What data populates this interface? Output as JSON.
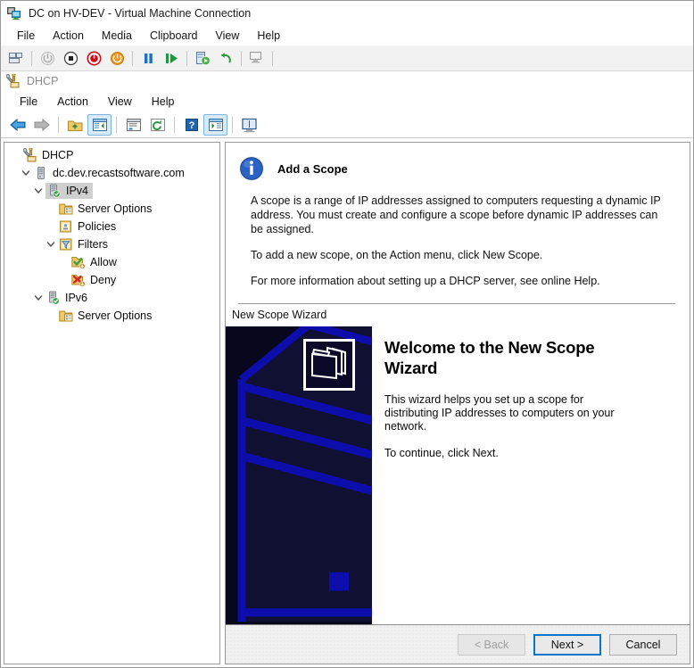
{
  "vm_window": {
    "title": "DC on HV-DEV - Virtual Machine Connection",
    "icon": "virtual-machine-icon",
    "menu": [
      "File",
      "Action",
      "Media",
      "Clipboard",
      "View",
      "Help"
    ],
    "toolbar": [
      {
        "name": "ctrl-alt-del-icon",
        "title": "Ctrl+Alt+Delete"
      },
      {
        "name": "start-icon",
        "title": "Start"
      },
      {
        "name": "shutdown-icon",
        "title": "Shut Down"
      },
      {
        "name": "turn-off-icon",
        "title": "Turn Off"
      },
      {
        "name": "save-state-icon",
        "title": "Save"
      },
      {
        "name": "pause-icon",
        "title": "Pause"
      },
      {
        "name": "resume-icon",
        "title": "Resume"
      },
      {
        "name": "checkpoint-icon",
        "title": "Checkpoint"
      },
      {
        "name": "revert-icon",
        "title": "Revert"
      },
      {
        "name": "enhanced-session-icon",
        "title": "Enhanced Session"
      }
    ]
  },
  "mmc": {
    "title": "DHCP",
    "icon": "dhcp-console-icon",
    "menu": [
      "File",
      "Action",
      "View",
      "Help"
    ],
    "toolbar": [
      {
        "name": "back-icon",
        "selected": false
      },
      {
        "name": "forward-icon",
        "selected": false
      },
      {
        "name": "up-one-level-icon",
        "selected": false
      },
      {
        "name": "show-hide-console-tree-icon",
        "selected": true
      },
      {
        "name": "properties-icon",
        "selected": false
      },
      {
        "name": "refresh-icon",
        "selected": false
      },
      {
        "name": "help-icon",
        "selected": false
      },
      {
        "name": "show-hide-action-pane-icon",
        "selected": true
      },
      {
        "name": "export-list-icon",
        "selected": false
      }
    ]
  },
  "tree": {
    "items": [
      {
        "label": "DHCP",
        "icon": "dhcp-console-icon",
        "indent": 0,
        "twisty": "none",
        "selected": false
      },
      {
        "label": "dc.dev.recastsoftware.com",
        "icon": "server-icon",
        "indent": 1,
        "twisty": "expanded",
        "selected": false
      },
      {
        "label": "IPv4",
        "icon": "ipv4-server-icon",
        "indent": 2,
        "twisty": "expanded",
        "selected": true
      },
      {
        "label": "Server Options",
        "icon": "server-options-folder-icon",
        "indent": 4,
        "twisty": "none",
        "selected": false
      },
      {
        "label": "Policies",
        "icon": "policies-folder-icon",
        "indent": 4,
        "twisty": "none",
        "selected": false
      },
      {
        "label": "Filters",
        "icon": "filters-funnel-icon",
        "indent": 3,
        "twisty": "expanded",
        "selected": false
      },
      {
        "label": "Allow",
        "icon": "allow-folder-icon",
        "indent": 5,
        "twisty": "none",
        "selected": false
      },
      {
        "label": "Deny",
        "icon": "deny-folder-icon",
        "indent": 5,
        "twisty": "none",
        "selected": false
      },
      {
        "label": "IPv6",
        "icon": "ipv6-server-icon",
        "indent": 2,
        "twisty": "expanded",
        "selected": false
      },
      {
        "label": "Server Options",
        "icon": "server-options-folder-icon",
        "indent": 4,
        "twisty": "none",
        "selected": false
      }
    ]
  },
  "detail": {
    "heading": "Add a Scope",
    "heading_icon": "info-icon",
    "paragraphs": [
      "A scope is a range of IP addresses assigned to computers requesting a dynamic IP address. You must create and configure a scope before dynamic IP addresses can be assigned.",
      "To add a new scope, on the Action menu, click New Scope.",
      "For more information about setting up a DHCP server, see online Help."
    ]
  },
  "wizard": {
    "caption": "New Scope Wizard",
    "banner_icon": "folders-stack-icon",
    "heading": "Welcome to the New Scope Wizard",
    "body": [
      "This wizard helps you set up a scope for distributing IP addresses to computers on your network.",
      "To continue, click Next."
    ],
    "buttons": [
      {
        "label": "< Back",
        "name": "back-button",
        "state": "disabled"
      },
      {
        "label": "Next >",
        "name": "next-button",
        "state": "default"
      },
      {
        "label": "Cancel",
        "name": "cancel-button",
        "state": "normal"
      }
    ]
  },
  "colors": {
    "banner_dark": "#070720",
    "banner_blue": "#0d0da8",
    "accent_blue": "#0a74c8",
    "selection_gray": "#cfcfcf"
  }
}
